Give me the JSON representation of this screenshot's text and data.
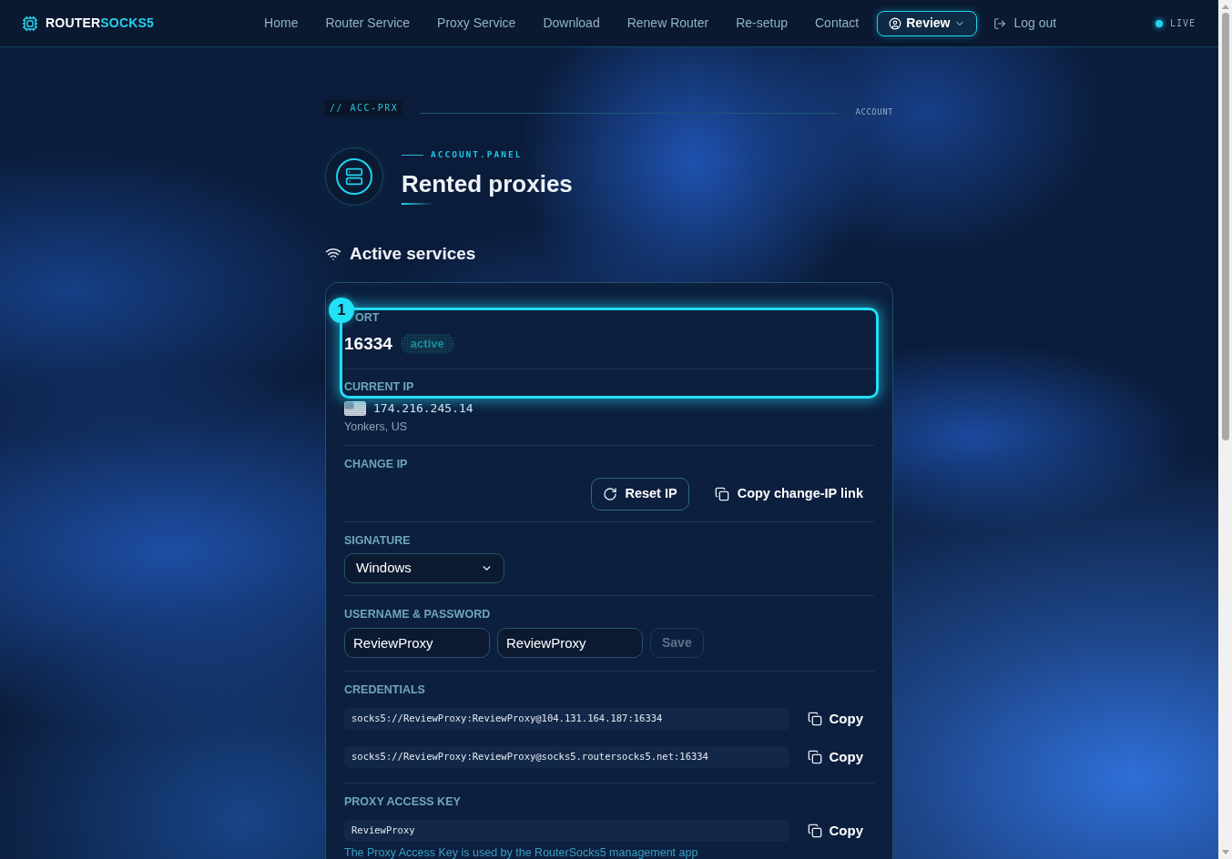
{
  "nav": {
    "logo": {
      "primary": "ROUTER",
      "accent": "SOCKS5"
    },
    "links": [
      "Home",
      "Router Service",
      "Proxy Service",
      "Download",
      "Renew Router",
      "Re-setup",
      "Contact"
    ],
    "account_menu": {
      "label": "Review"
    },
    "logout": "Log out",
    "status": "LIVE"
  },
  "breadcrumb": {
    "code": "// ACC-PRX",
    "section": "ACCOUNT"
  },
  "header": {
    "eyebrow": "ACCOUNT.PANEL",
    "title": "Rented proxies"
  },
  "section_title": "Active services",
  "service": {
    "tour_step": "1",
    "port": {
      "label": "ORT",
      "value": "16334",
      "status": "active"
    },
    "current_ip": {
      "label": "CURRENT IP",
      "ip": "174.216.245.14",
      "location": "Yonkers, US"
    },
    "change_ip": {
      "label": "CHANGE IP",
      "buttons": [
        {
          "label": "Reset IP",
          "kind": "reset"
        },
        {
          "label": "Copy change-IP link",
          "kind": "copy"
        }
      ]
    },
    "signature": {
      "label": "SIGNATURE",
      "value": "Windows"
    },
    "auth": {
      "label": "USERNAME & PASSWORD",
      "username": "ReviewProxy",
      "password": "ReviewProxy",
      "save": {
        "label": "Save",
        "disabled": true
      }
    },
    "credentials": {
      "label": "CREDENTIALS",
      "items": [
        {
          "value": "socks5://ReviewProxy:ReviewProxy@104.131.164.187:16334",
          "action": "Copy"
        },
        {
          "value": "socks5://ReviewProxy:ReviewProxy@socks5.routersocks5.net:16334",
          "action": "Copy"
        }
      ]
    },
    "access_key": {
      "label": "PROXY ACCESS KEY",
      "value": "ReviewProxy",
      "action": "Copy",
      "note": "The Proxy Access Key is used by the RouterSocks5 management app"
    }
  }
}
